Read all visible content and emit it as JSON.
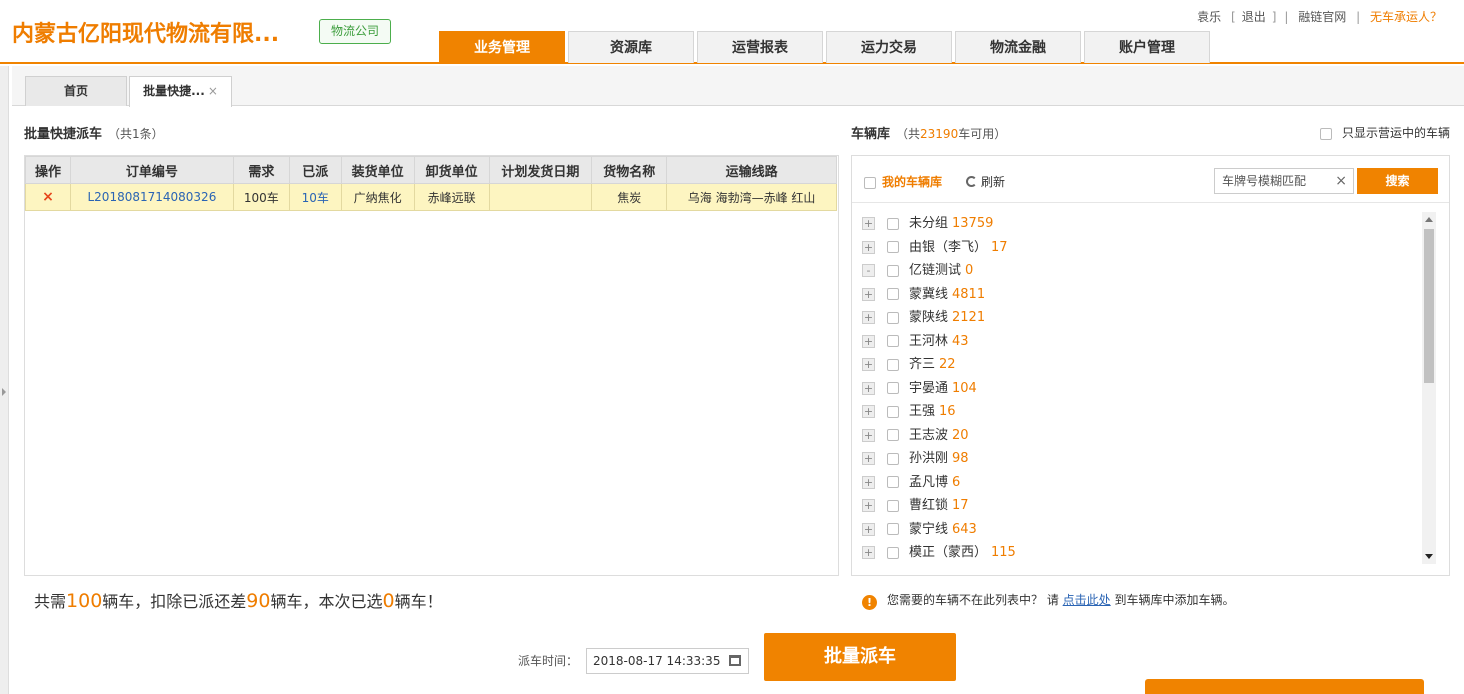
{
  "header": {
    "company": "内蒙古亿阳现代物流有限...",
    "tag": "物流公司",
    "user": "袁乐",
    "logout": "退出",
    "site_link": "融链官网",
    "no_car_link": "无车承运人？",
    "nav": [
      "业务管理",
      "资源库",
      "运营报表",
      "运力交易",
      "物流金融",
      "账户管理"
    ],
    "active_nav": "业务管理"
  },
  "page_tabs": {
    "home": "首页",
    "current": "批量快捷..."
  },
  "orders": {
    "title": "批量快捷派车",
    "count_text": "（共1条）",
    "columns": [
      "操作",
      "订单编号",
      "需求",
      "已派",
      "装货单位",
      "卸货单位",
      "计划发货日期",
      "货物名称",
      "运输线路"
    ],
    "rows": [
      {
        "action": "×",
        "order_no": "L2018081714080326",
        "demand": "100车",
        "dispatched": "10车",
        "load_unit": "广纳焦化",
        "unload_unit": "赤峰远联",
        "plan_date": "",
        "goods": "焦炭",
        "route": "乌海 海勃湾—赤峰 红山"
      }
    ]
  },
  "summary": {
    "p1": "共需",
    "need": "100",
    "p2": "辆车，扣除已派还差",
    "remain": "90",
    "p3": "辆车，本次已选",
    "selected": "0",
    "p4": "辆车！"
  },
  "dispatch": {
    "label": "派车时间：",
    "time": "2018-08-17 14:33:35",
    "button": "批量派车"
  },
  "vehicles": {
    "title": "车辆库",
    "count_prefix": "（共",
    "available": "23190",
    "count_suffix": "车可用）",
    "only_running": "只显示营运中的车辆",
    "my_library": "我的车辆库",
    "refresh": "刷新",
    "search_placeholder": "车牌号模糊匹配",
    "search_button": "搜索",
    "groups": [
      {
        "name": "未分组",
        "count": "13759",
        "expander": "+"
      },
      {
        "name": "由银（李飞）",
        "count": "17",
        "expander": "+"
      },
      {
        "name": "亿链测试",
        "count": "0",
        "expander": "-"
      },
      {
        "name": "蒙冀线",
        "count": "4811",
        "expander": "+"
      },
      {
        "name": "蒙陕线",
        "count": "2121",
        "expander": "+"
      },
      {
        "name": "王河林",
        "count": "43",
        "expander": "+"
      },
      {
        "name": "齐三",
        "count": "22",
        "expander": "+"
      },
      {
        "name": "宇晏通",
        "count": "104",
        "expander": "+"
      },
      {
        "name": "王强",
        "count": "16",
        "expander": "+"
      },
      {
        "name": "王志波",
        "count": "20",
        "expander": "+"
      },
      {
        "name": "孙洪刚",
        "count": "98",
        "expander": "+"
      },
      {
        "name": "孟凡博",
        "count": "6",
        "expander": "+"
      },
      {
        "name": "曹红锁",
        "count": "17",
        "expander": "+"
      },
      {
        "name": "蒙宁线",
        "count": "643",
        "expander": "+"
      },
      {
        "name": "模正（蒙西）",
        "count": "115",
        "expander": "+"
      }
    ]
  },
  "notice": {
    "text1": "您需要的车辆不在此列表中？ 请 ",
    "link": "点击此处",
    "text2": " 到车辆库中添加车辆。"
  },
  "colors": {
    "accent": "#f08300",
    "link": "#2a64b4",
    "row_highlight": "#fdf5c1"
  }
}
